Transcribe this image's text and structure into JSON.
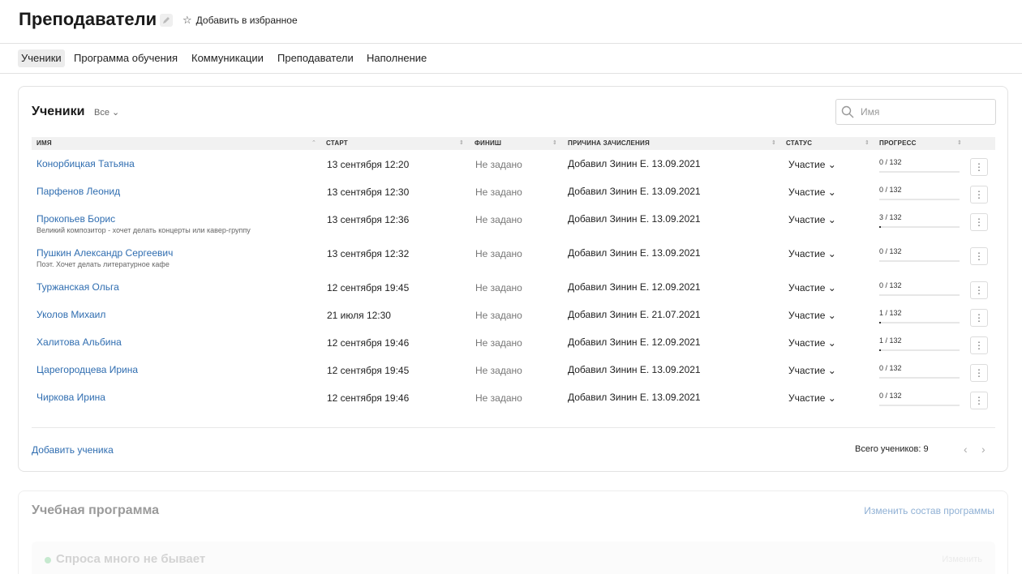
{
  "header": {
    "title": "Преподаватели",
    "favorite_label": "Добавить в избранное"
  },
  "tabs": [
    {
      "label": "Ученики",
      "active": true
    },
    {
      "label": "Программа обучения",
      "active": false
    },
    {
      "label": "Коммуникации",
      "active": false
    },
    {
      "label": "Преподаватели",
      "active": false
    },
    {
      "label": "Наполнение",
      "active": false
    }
  ],
  "students": {
    "title": "Ученики",
    "filter": "Все",
    "search_placeholder": "Имя",
    "columns": [
      "ИМЯ",
      "СТАРТ",
      "ФИНИШ",
      "ПРИЧИНА ЗАЧИСЛЕНИЯ",
      "СТАТУС",
      "ПРОГРЕСС"
    ],
    "rows": [
      {
        "name": "Конорбицкая Татьяна",
        "desc": "",
        "start": "13 сентября 12:20",
        "finish": "Не задано",
        "reason": "Добавил Зинин Е. 13.09.2021",
        "status": "Участие",
        "progress": "0 / 132",
        "progress_fraction": 0
      },
      {
        "name": "Парфенов Леонид",
        "desc": "",
        "start": "13 сентября 12:30",
        "finish": "Не задано",
        "reason": "Добавил Зинин Е. 13.09.2021",
        "status": "Участие",
        "progress": "0 / 132",
        "progress_fraction": 0
      },
      {
        "name": "Прокопьев Борис",
        "desc": "Великий композитор - хочет делать концерты или кавер-группу",
        "start": "13 сентября 12:36",
        "finish": "Не задано",
        "reason": "Добавил Зинин Е. 13.09.2021",
        "status": "Участие",
        "progress": "3 / 132",
        "progress_fraction": 0.0227
      },
      {
        "name": "Пушкин Александр Сергеевич",
        "desc": "Поэт. Хочет делать литературное кафе",
        "start": "13 сентября 12:32",
        "finish": "Не задано",
        "reason": "Добавил Зинин Е. 13.09.2021",
        "status": "Участие",
        "progress": "0 / 132",
        "progress_fraction": 0
      },
      {
        "name": "Туржанская Ольга",
        "desc": "",
        "start": "12 сентября 19:45",
        "finish": "Не задано",
        "reason": "Добавил Зинин Е. 12.09.2021",
        "status": "Участие",
        "progress": "0 / 132",
        "progress_fraction": 0
      },
      {
        "name": "Уколов Михаил",
        "desc": "",
        "start": "21 июля 12:30",
        "finish": "Не задано",
        "reason": "Добавил Зинин Е. 21.07.2021",
        "status": "Участие",
        "progress": "1 / 132",
        "progress_fraction": 0.0076
      },
      {
        "name": "Халитова Альбина",
        "desc": "",
        "start": "12 сентября 19:46",
        "finish": "Не задано",
        "reason": "Добавил Зинин Е. 12.09.2021",
        "status": "Участие",
        "progress": "1 / 132",
        "progress_fraction": 0.0076
      },
      {
        "name": "Царегородцева Ирина",
        "desc": "",
        "start": "12 сентября 19:45",
        "finish": "Не задано",
        "reason": "Добавил Зинин Е. 13.09.2021",
        "status": "Участие",
        "progress": "0 / 132",
        "progress_fraction": 0
      },
      {
        "name": "Чиркова Ирина",
        "desc": "",
        "start": "12 сентября 19:46",
        "finish": "Не задано",
        "reason": "Добавил Зинин Е. 13.09.2021",
        "status": "Участие",
        "progress": "0 / 132",
        "progress_fraction": 0
      }
    ],
    "add_label": "Добавить ученика",
    "total_label": "Всего учеников: 9"
  },
  "program": {
    "title": "Учебная программа",
    "change_label": "Изменить состав программы",
    "module_title": "Спроса много не бывает",
    "module_edit_label": "Изменить"
  }
}
